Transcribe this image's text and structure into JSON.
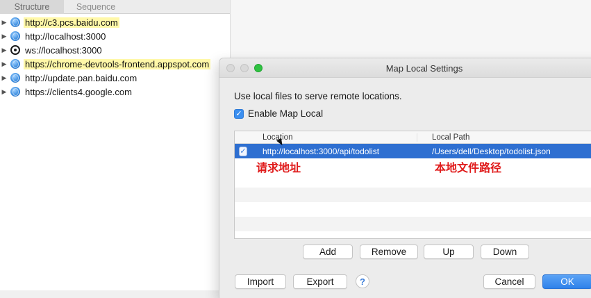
{
  "structure_panel": {
    "tabs": [
      {
        "label": "Structure",
        "active": true
      },
      {
        "label": "Sequence",
        "active": false
      }
    ],
    "hosts": [
      {
        "label": "http://c3.pcs.baidu.com",
        "icon": "globe-icon",
        "highlighted": true
      },
      {
        "label": "http://localhost:3000",
        "icon": "globe-icon",
        "highlighted": false
      },
      {
        "label": "ws://localhost:3000",
        "icon": "websocket-icon",
        "highlighted": false
      },
      {
        "label": "https://chrome-devtools-frontend.appspot.com",
        "icon": "globe-icon",
        "highlighted": true
      },
      {
        "label": "http://update.pan.baidu.com",
        "icon": "globe-icon",
        "highlighted": false
      },
      {
        "label": "https://clients4.google.com",
        "icon": "globe-icon",
        "highlighted": false
      }
    ]
  },
  "dialog": {
    "title": "Map Local Settings",
    "description": "Use local files to serve remote locations.",
    "enable_label": "Enable Map Local",
    "enable_checked": true,
    "table": {
      "columns": [
        "Location",
        "Local Path"
      ],
      "rows": [
        {
          "checked": true,
          "location": "http://localhost:3000/api/todolist",
          "local_path": "/Users/dell/Desktop/todolist.json"
        }
      ],
      "annotations": {
        "location": "请求地址",
        "local_path": "本地文件路径"
      }
    },
    "row_buttons": {
      "add": "Add",
      "remove": "Remove",
      "up": "Up",
      "down": "Down"
    },
    "bottom_buttons": {
      "import": "Import",
      "export": "Export",
      "help": "?",
      "cancel": "Cancel",
      "ok": "OK"
    }
  },
  "colors": {
    "highlight": "#fff8a8",
    "selection": "#2e6fd1",
    "annotation": "#e01b1b",
    "accent": "#3b8ff0"
  }
}
